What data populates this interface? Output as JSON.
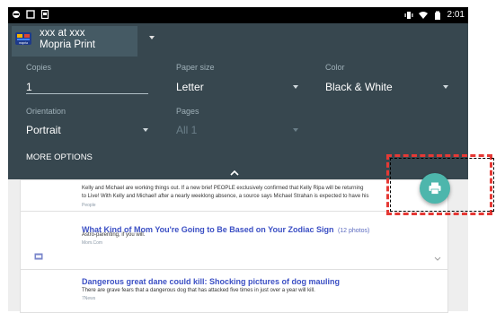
{
  "status_bar": {
    "time": "2:01",
    "left_icons": [
      "notification-icon",
      "screenshot-icon",
      "image-icon"
    ],
    "right_icons": [
      "vibrate-icon",
      "wifi-icon",
      "battery-icon"
    ]
  },
  "printer": {
    "name_line1": "xxx at xxx",
    "name_line2": "Mopria Print",
    "logo_text": "mopria"
  },
  "options": {
    "copies": {
      "label": "Copies",
      "value": "1"
    },
    "paper_size": {
      "label": "Paper size",
      "value": "Letter"
    },
    "color": {
      "label": "Color",
      "value": "Black & White"
    },
    "orientation": {
      "label": "Orientation",
      "value": "Portrait"
    },
    "pages": {
      "label": "Pages",
      "value": "All 1"
    },
    "more_options": "MORE OPTIONS"
  },
  "feed": {
    "partial_line1": "Kelly and Michael are working things out. If a new brief PEOPLE exclusively confirmed that Kelly Ripa will be returning",
    "partial_line2": "to Live! With Kelly and Michael! after a nearly weeklong absence, a source says Michael Strahan is expected to have his",
    "partial_source": "People",
    "items": [
      {
        "headline": "What Kind of Mom You're Going to Be Based on Your Zodiac Sign",
        "count": "(12 photos)",
        "snippet": "Astro-parenting, if you will.",
        "source": "Mom.Com"
      },
      {
        "headline": "Dangerous great dane could kill: Shocking pictures of dog mauling",
        "count": "",
        "snippet": "There are grave fears that a dangerous dog that has attacked five times in just over a year will kill.",
        "source": "7News"
      }
    ]
  },
  "colors": {
    "panel": "#37474F",
    "fab": "#4db6ac",
    "accent_red": "#e53935"
  }
}
